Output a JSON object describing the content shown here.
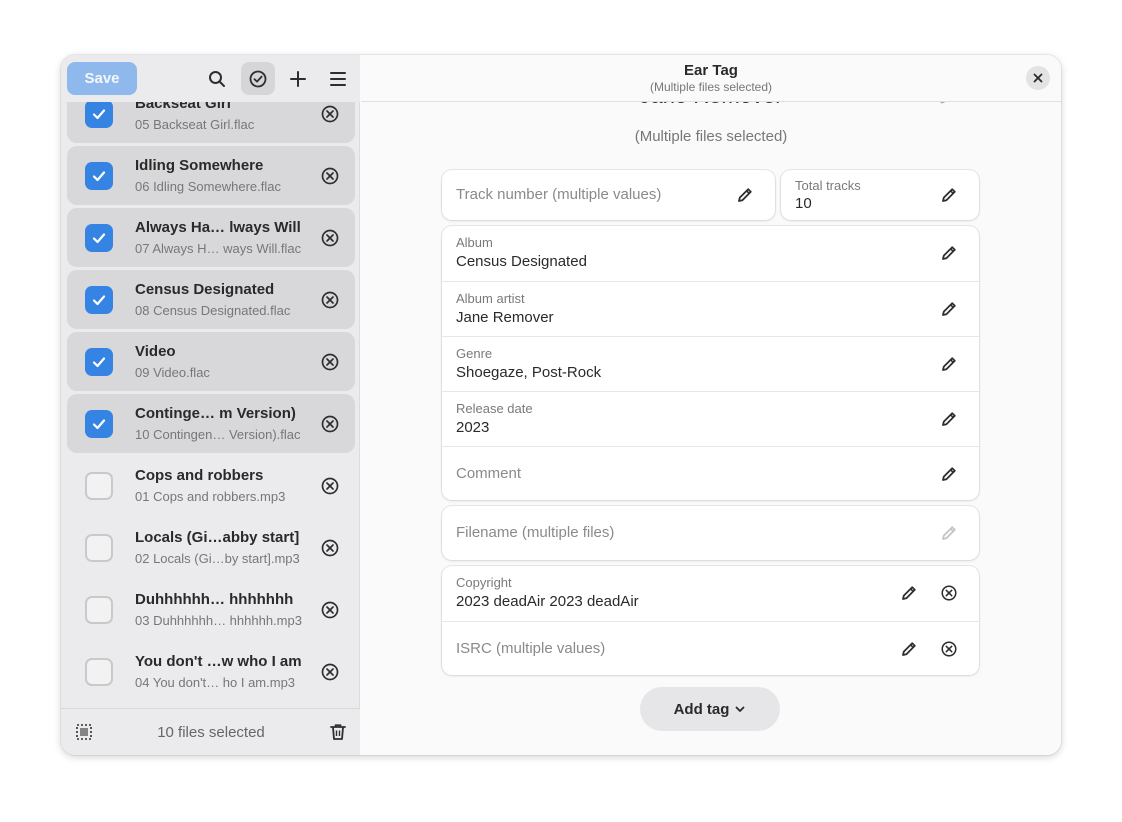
{
  "sidebar": {
    "save_label": "Save",
    "footer_text": "10 files selected",
    "files": [
      {
        "title": "Backseat Girl",
        "filename": "05 Backseat Girl.flac",
        "checked": true
      },
      {
        "title": "Idling Somewhere",
        "filename": "06 Idling Somewhere.flac",
        "checked": true
      },
      {
        "title": "Always Ha… lways Will",
        "filename": "07 Always H… ways Will.flac",
        "checked": true
      },
      {
        "title": "Census Designated",
        "filename": "08 Census Designated.flac",
        "checked": true
      },
      {
        "title": "Video",
        "filename": "09 Video.flac",
        "checked": true
      },
      {
        "title": "Continge…  m Version)",
        "filename": "10 Contingen…  Version).flac",
        "checked": true
      },
      {
        "title": "Cops and robbers",
        "filename": "01 Cops and robbers.mp3",
        "checked": false
      },
      {
        "title": "Locals (Gi…abby start]",
        "filename": "02 Locals (Gi…by start].mp3",
        "checked": false
      },
      {
        "title": "Duhhhhhh… hhhhhhh",
        "filename": "03 Duhhhhhh… hhhhhh.mp3",
        "checked": false
      },
      {
        "title": "You don't …w who I am",
        "filename": "04 You don't…  ho I am.mp3",
        "checked": false
      }
    ]
  },
  "header": {
    "title": "Ear Tag",
    "subtitle": "(Multiple files selected)"
  },
  "main": {
    "artist_value": "Jane Remover",
    "multiple_label": "(Multiple files selected)",
    "track_number_placeholder": "Track number (multiple values)",
    "total_tracks": {
      "label": "Total tracks",
      "value": "10"
    },
    "album": {
      "label": "Album",
      "value": "Census Designated"
    },
    "album_artist": {
      "label": "Album artist",
      "value": "Jane Remover"
    },
    "genre": {
      "label": "Genre",
      "value": "Shoegaze, Post-Rock"
    },
    "release_date": {
      "label": "Release date",
      "value": "2023"
    },
    "comment_placeholder": "Comment",
    "filename_placeholder": "Filename (multiple files)",
    "copyright": {
      "label": "Copyright",
      "value": "2023 deadAir 2023 deadAir"
    },
    "isrc_placeholder": "ISRC (multiple values)",
    "add_tag_label": "Add tag"
  },
  "colors": {
    "accent": "#3584e4",
    "save_button": "#8fb8ec",
    "sidebar_bg": "#ebebed",
    "selected_row": "#d8d8da"
  },
  "icons": [
    "search-icon",
    "select-mode-icon",
    "add-icon",
    "menu-icon",
    "close-icon",
    "pencil-icon",
    "remove-circle-icon",
    "select-all-icon",
    "trash-icon",
    "chevron-down-icon",
    "checkmark-icon"
  ]
}
